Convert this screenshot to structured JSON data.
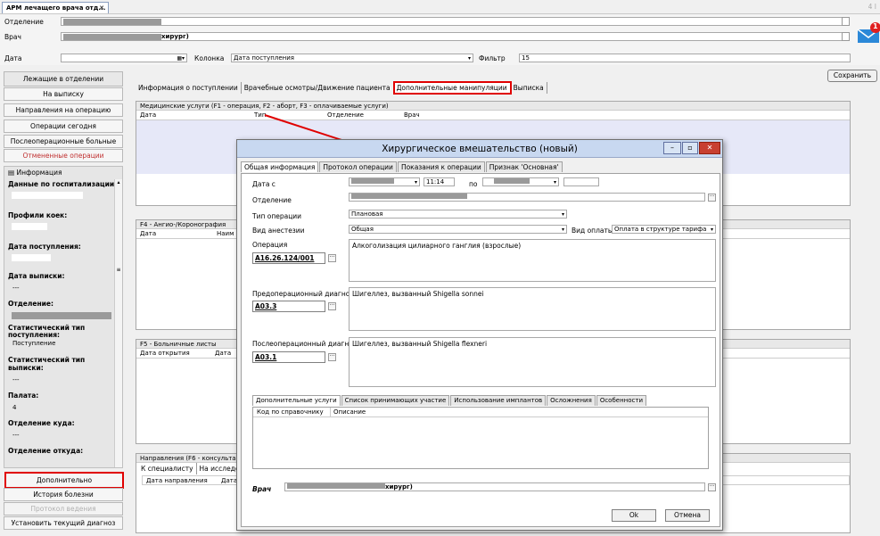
{
  "window": {
    "tab_title": "АРМ лечащего врача отд...",
    "tab_close": "✕",
    "corner": "4 I"
  },
  "header": {
    "department_label": "Отделение",
    "doctor_label": "Врач",
    "doctor_value_tail": "хирург)",
    "date_label": "Дата",
    "column_label": "Колонка",
    "column_value": "Дата поступления",
    "filter_label": "Фильтр",
    "filter_value": "15",
    "save_button": "Сохранить",
    "mail_badge": "1"
  },
  "left_nav": {
    "items": [
      "Лежащие в отделении",
      "На выписку",
      "Направления на операцию",
      "Операции сегодня",
      "Послеоперационные больные",
      "Отмененные операции"
    ],
    "bottom": [
      "Дополнительно",
      "История болезни",
      "Протокол ведения",
      "Установить текущий диагноз"
    ]
  },
  "info": {
    "header": "Информация",
    "fields": [
      {
        "k": "Данные по госпитализации:",
        "v": ""
      },
      {
        "k": "Профили коек:",
        "v": ""
      },
      {
        "k": "Дата поступления:",
        "v": ""
      },
      {
        "k": "Дата выписки:",
        "v": "---"
      },
      {
        "k": "Отделение:",
        "v": ""
      },
      {
        "k": "Статистический тип поступления:",
        "v": "Поступление"
      },
      {
        "k": "Статистический тип выписки:",
        "v": "---"
      },
      {
        "k": "Палата:",
        "v": "4"
      },
      {
        "k": "Отделение куда:",
        "v": "---"
      },
      {
        "k": "Отделение откуда:",
        "v": ""
      }
    ]
  },
  "content_tabs": [
    "Информация о поступлении",
    "Врачебные осмотры/Движение пациента",
    "Дополнительные манипуляции",
    "Выписка"
  ],
  "panels": {
    "med": {
      "title": "Медицинские услуги (F1 - операция, F2 - аборт, F3 - оплачиваемые услуги)",
      "cols": [
        "Дата",
        "Тип",
        "Отделение",
        "Врач"
      ]
    },
    "angio": {
      "title": "F4 - Ангио-/Коронография",
      "cols": [
        "Дата",
        "Наим"
      ]
    },
    "sick": {
      "title": "F5 - Больничные листы",
      "cols": [
        "Дата открытия",
        "Дата"
      ]
    },
    "dir": {
      "title": "Направления (F6 - консультац",
      "tabs": [
        "К специалисту",
        "На исследова"
      ],
      "cols": [
        "Дата направления",
        "Дата"
      ]
    }
  },
  "dialog": {
    "title": "Хирургическое вмешательство (новый)",
    "tabs": [
      "Общая информация",
      "Протокол операции",
      "Показания к операции",
      "Признак 'Основная'"
    ],
    "date_from_label": "Дата с",
    "time_value": "11:14",
    "to_label": "по",
    "department_label": "Отделение",
    "op_type_label": "Тип операции",
    "op_type_value": "Плановая",
    "anesthesia_label": "Вид анестезии",
    "anesthesia_value": "Общая",
    "payment_label": "Вид оплаты",
    "payment_value": "Оплата в структуре тарифа",
    "operation_label": "Операция",
    "operation_code": "A16.26.124/001",
    "operation_text": "Алкоголизация цилиарного ганглия (взрослые)",
    "preop_label": "Предоперационный диагноз",
    "preop_code": "A03.3",
    "preop_text": "Шигеллез, вызванный Shigella sonnei",
    "postop_label": "Послеоперационный диагноз",
    "postop_code": "A03.1",
    "postop_text": "Шигеллез, вызванный Shigella flexneri",
    "sub_tabs": [
      "Дополнительные услуги",
      "Список принимающих участие",
      "Использование имплантов",
      "Осложнения",
      "Особенности"
    ],
    "sub_cols": [
      "Код по справочнику",
      "Описание"
    ],
    "doctor_label": "Врач",
    "doctor_tail": "хирург)",
    "ok": "Ok",
    "cancel": "Отмена"
  }
}
